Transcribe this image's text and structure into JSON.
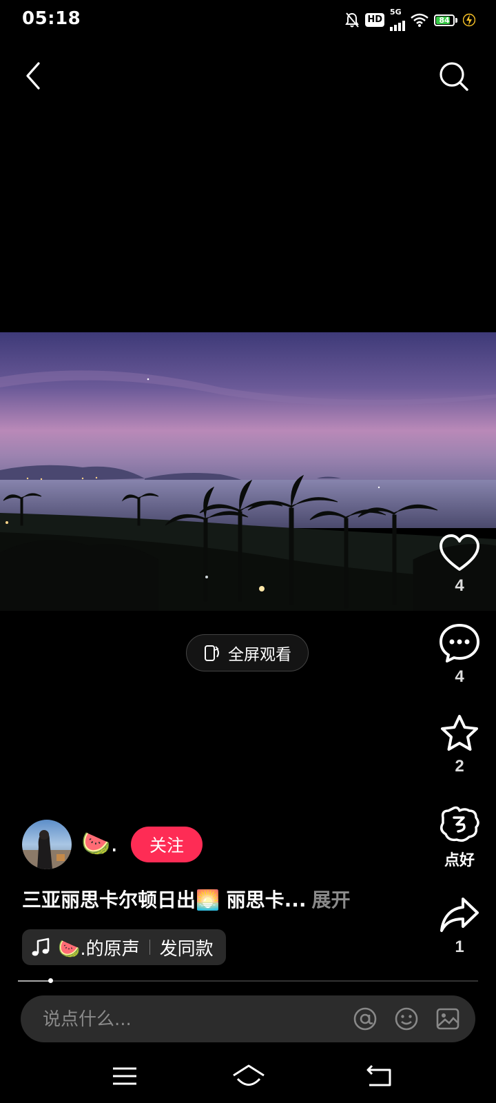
{
  "status_bar": {
    "time": "05:18",
    "network_badge": "HD",
    "network_type": "5G",
    "battery_level": 84,
    "battery_label": "84",
    "icons": [
      "mute-notification-icon",
      "hd-icon",
      "signal-icon",
      "wifi-icon",
      "battery-icon",
      "charging-bolt-icon"
    ]
  },
  "nav": {
    "back_icon": "chevron-left-icon",
    "search_icon": "search-icon"
  },
  "video": {
    "fullscreen_label": "全屏观看",
    "fullscreen_icon": "rotate-screen-icon"
  },
  "actions": {
    "like": {
      "icon": "heart-icon",
      "count": "4"
    },
    "comment": {
      "icon": "chat-bubble-icon",
      "count": "4"
    },
    "favorite": {
      "icon": "star-icon",
      "count": "2"
    },
    "rate": {
      "icon": "thumbs-ok-icon",
      "label": "点好"
    },
    "share": {
      "icon": "share-arrow-icon",
      "count": "1"
    }
  },
  "author": {
    "name": "🍉.",
    "follow_label": "关注"
  },
  "caption": {
    "text": "三亚丽思卡尔顿日出🌅 丽思卡...",
    "more_label": "展开"
  },
  "music": {
    "icon": "music-note-icon",
    "title": "🍉.的原声",
    "action_label": "发同款"
  },
  "progress": {
    "fraction": 0.07
  },
  "comment_bar": {
    "placeholder": "说点什么...",
    "icons": [
      "at-icon",
      "emoji-icon",
      "image-icon"
    ]
  },
  "system_nav": {
    "icons": [
      "menu-icon",
      "home-icon",
      "back-icon"
    ]
  },
  "colors": {
    "accent": "#fe2c55",
    "background": "#000000",
    "battery": "#36c946"
  }
}
